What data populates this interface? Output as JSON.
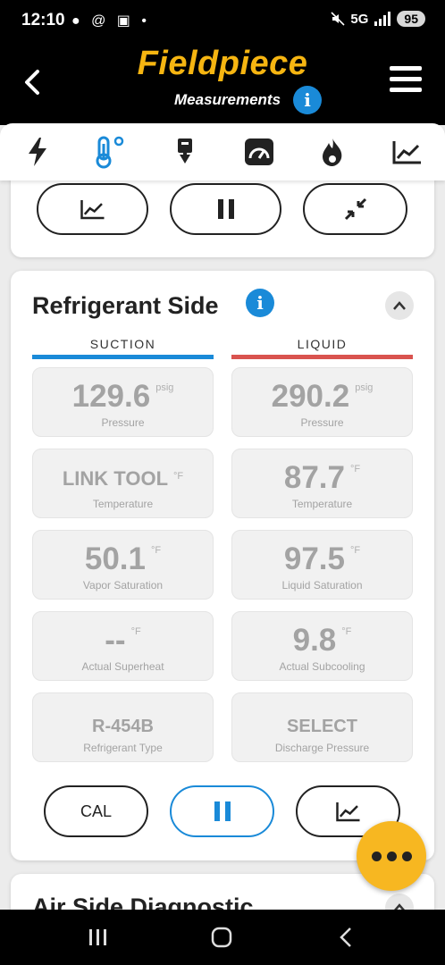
{
  "status": {
    "time": "12:10",
    "notif_icons": "● @ ▣ •",
    "network": "5G",
    "battery": "95"
  },
  "header": {
    "logo": "Fieldpiece",
    "subtitle": "Measurements",
    "info": "i"
  },
  "tabs": [
    {
      "icon": "lightning-icon",
      "active": false
    },
    {
      "icon": "thermometer-icon",
      "active": true
    },
    {
      "icon": "probe-icon",
      "active": false
    },
    {
      "icon": "gauge-icon",
      "active": false
    },
    {
      "icon": "flame-icon",
      "active": false
    },
    {
      "icon": "trend-chart-icon",
      "active": false
    }
  ],
  "refrigerant": {
    "title": "Refrigerant Side",
    "info": "i",
    "suction_label": "SUCTION",
    "liquid_label": "LIQUID",
    "suction_color": "#1a8ad8",
    "liquid_color": "#d9534f",
    "tiles": {
      "suction_pressure": {
        "value": "129.6",
        "unit": "psig",
        "label": "Pressure"
      },
      "liquid_pressure": {
        "value": "290.2",
        "unit": "psig",
        "label": "Pressure"
      },
      "suction_temp": {
        "value": "LINK TOOL",
        "unit": "°F",
        "label": "Temperature"
      },
      "liquid_temp": {
        "value": "87.7",
        "unit": "°F",
        "label": "Temperature"
      },
      "vapor_sat": {
        "value": "50.1",
        "unit": "°F",
        "label": "Vapor Saturation"
      },
      "liquid_sat": {
        "value": "97.5",
        "unit": "°F",
        "label": "Liquid Saturation"
      },
      "superheat": {
        "value": "--",
        "unit": "°F",
        "label": "Actual Superheat"
      },
      "subcooling": {
        "value": "9.8",
        "unit": "°F",
        "label": "Actual Subcooling"
      },
      "ref_type": {
        "value": "R-454B",
        "label": "Refrigerant Type"
      },
      "discharge": {
        "value": "SELECT",
        "label": "Discharge Pressure"
      }
    },
    "cal_label": "CAL"
  },
  "air_side": {
    "title": "Air Side Diagnostic"
  },
  "colors": {
    "brand": "#f6b511",
    "accent": "#1a8ad8",
    "fab": "#f7b721"
  }
}
